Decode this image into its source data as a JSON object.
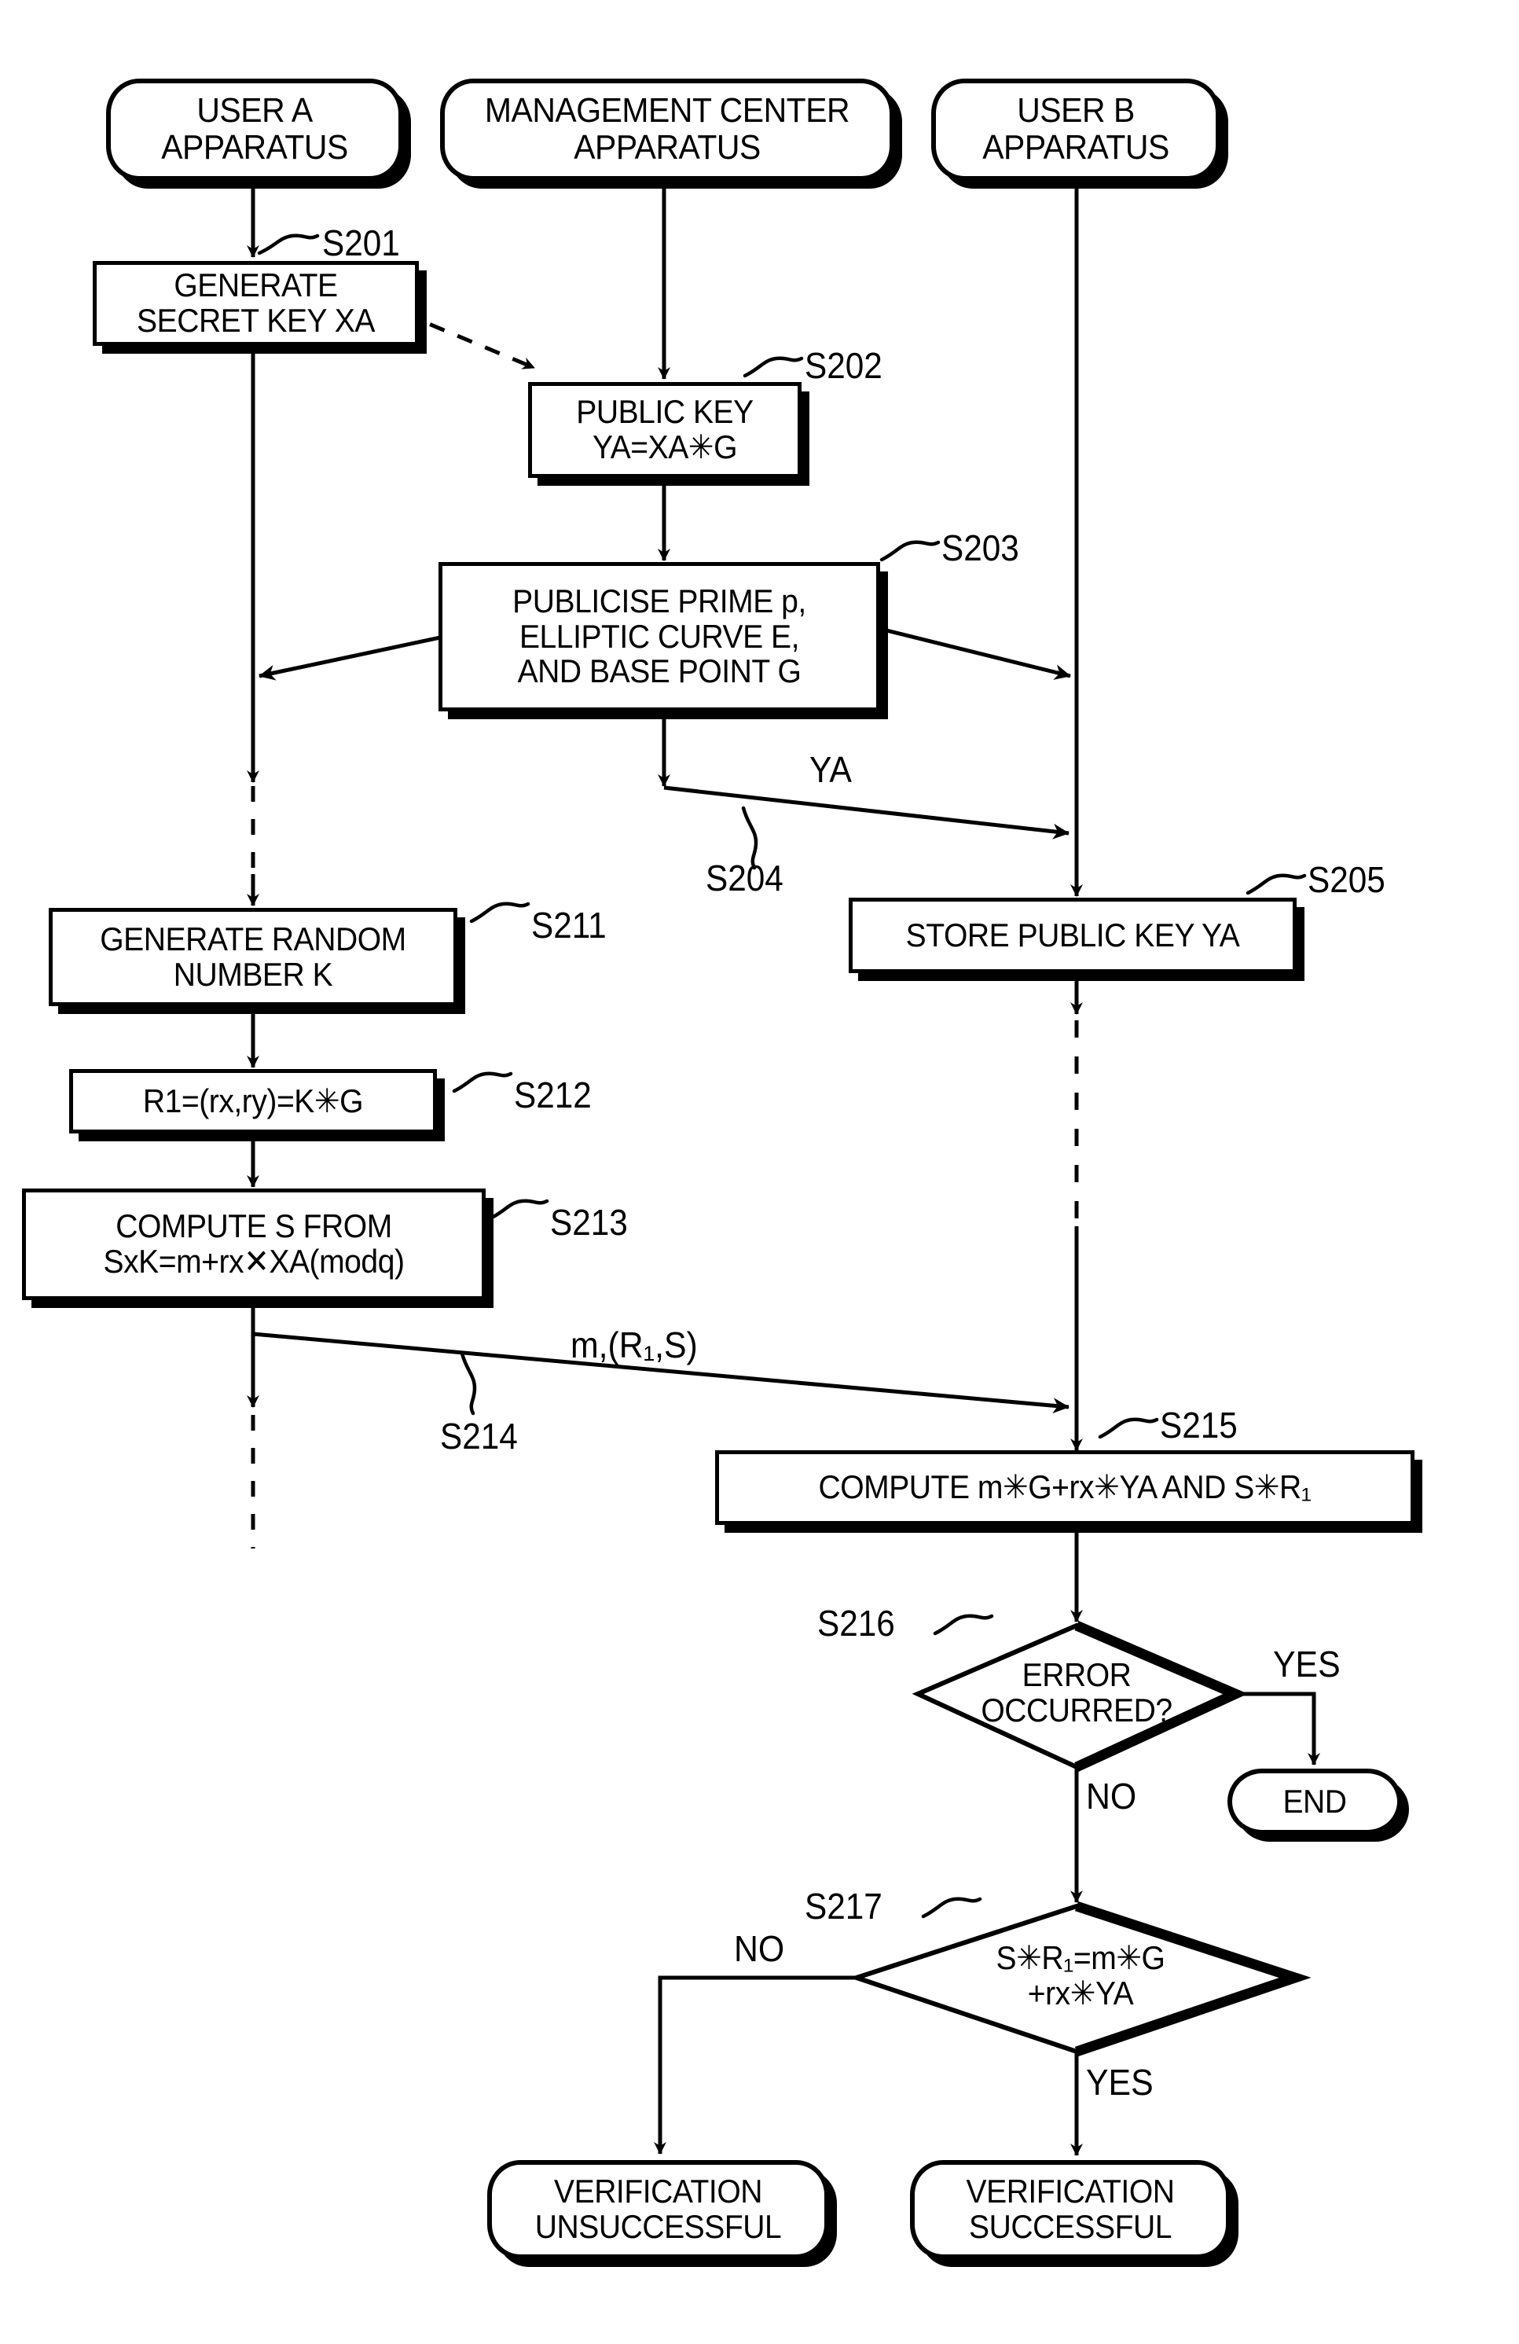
{
  "diagram": {
    "title": "Digital signature generation and verification flow (ECDSA)",
    "ink_color": "#000000",
    "background_color": "#ffffff"
  },
  "lanes": [
    {
      "id": "user-a",
      "label_line1": "USER A",
      "label_line2": "APPARATUS"
    },
    {
      "id": "management-center",
      "label_line1": "MANAGEMENT CENTER",
      "label_line2": "APPARATUS"
    },
    {
      "id": "user-b",
      "label_line1": "USER B",
      "label_line2": "APPARATUS"
    }
  ],
  "nodes": {
    "s201": {
      "step": "S201",
      "line1": "GENERATE",
      "line2": "SECRET KEY XA"
    },
    "s202": {
      "step": "S202",
      "line1": "PUBLIC KEY",
      "line2": "YA=XA✳G"
    },
    "s203": {
      "step": "S203",
      "line1": "PUBLICISE PRIME p,",
      "line2": "ELLIPTIC CURVE E,",
      "line3": "AND BASE POINT G"
    },
    "s205": {
      "step": "S205",
      "line1": "STORE PUBLIC KEY YA"
    },
    "s211": {
      "step": "S211",
      "line1": "GENERATE RANDOM",
      "line2": "NUMBER K"
    },
    "s212": {
      "step": "S212",
      "line1": "R1=(rx,ry)=K✳G"
    },
    "s213": {
      "step": "S213",
      "line1": "COMPUTE S FROM",
      "line2": "SxK=m+rx✕XA(modq)"
    },
    "s215": {
      "step": "S215",
      "line1": "COMPUTE m✳G+rx✳YA AND S✳R₁"
    },
    "s216": {
      "step": "S216",
      "line1": "ERROR",
      "line2": "OCCURRED?"
    },
    "s217": {
      "step": "S217",
      "line1": "S✳R₁=m✳G",
      "line2": "+rx✳YA"
    },
    "end": {
      "label": "END"
    },
    "verification_unsuccessful": {
      "line1": "VERIFICATION",
      "line2": "UNSUCCESSFUL"
    },
    "verification_successful": {
      "line1": "VERIFICATION",
      "line2": "SUCCESSFUL"
    }
  },
  "flow_labels": {
    "ya_transfer": {
      "text": "YA",
      "step": "S204"
    },
    "signature_send": {
      "text": "m,(R₁,S)",
      "step": "S214"
    },
    "error_yes": "YES",
    "error_no": "NO",
    "verify_no": "NO",
    "verify_yes": "YES"
  }
}
